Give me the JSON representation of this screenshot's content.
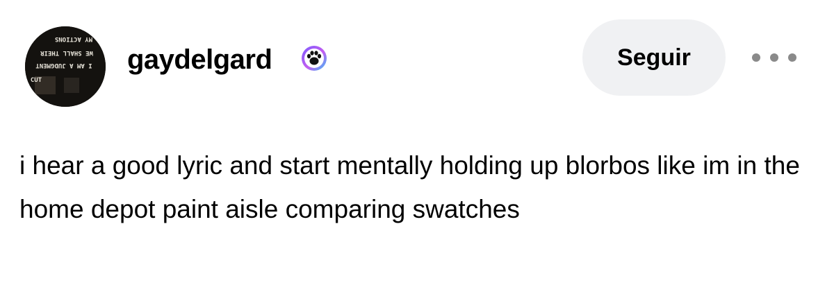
{
  "avatar": {
    "icon": "profile-avatar-photo",
    "caption_lines": [
      "MY ACTIONS",
      "WE SHALL THEIR",
      "I AM A JUDGMENT",
      "CUT"
    ]
  },
  "user": {
    "username": "gaydelgard",
    "badge_icon": "paw-badge-icon",
    "badge_colors": [
      "#7b5cff",
      "#c45cf0",
      "#36c2f5"
    ]
  },
  "actions": {
    "follow_label": "Seguir",
    "more_icon": "more-options-icon"
  },
  "post": {
    "text": "i hear a good lyric and start mentally holding up blorbos like im in the home depot paint aisle comparing swatches"
  }
}
